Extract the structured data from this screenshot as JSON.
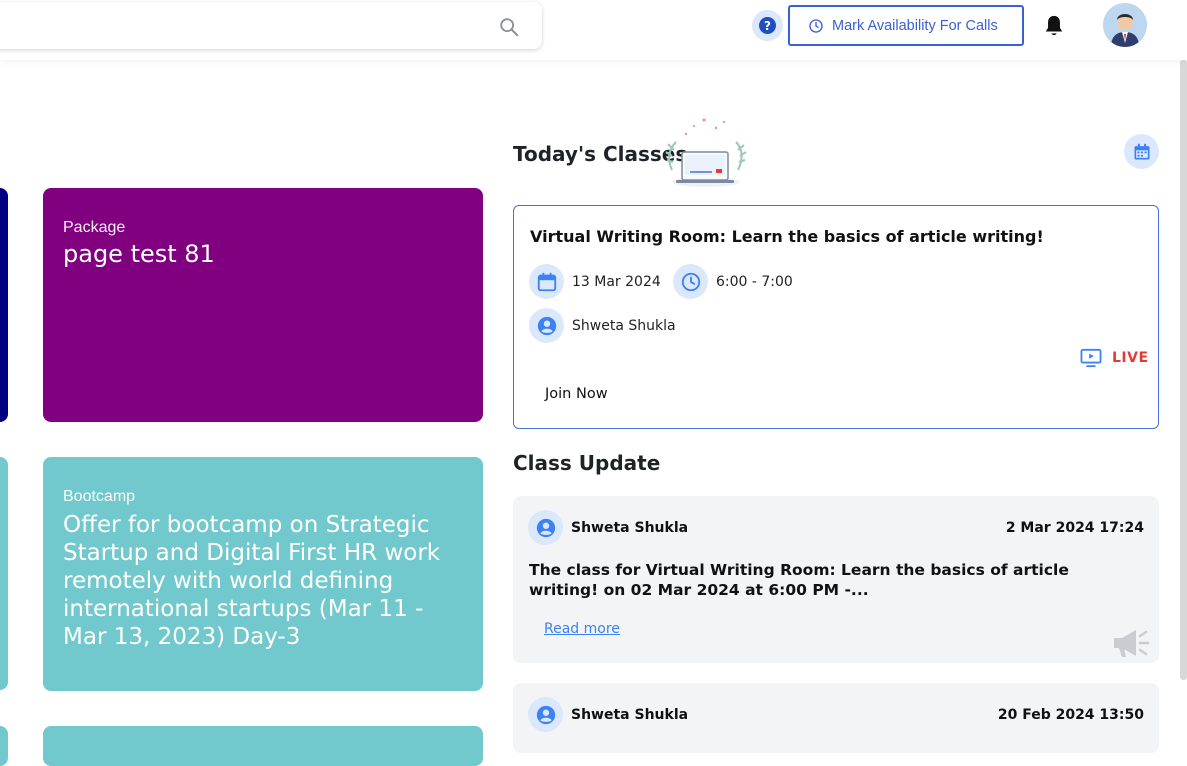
{
  "header": {
    "search": {
      "placeholder": "",
      "value": ""
    },
    "help_label": "?",
    "availability_button": "Mark Availability For Calls"
  },
  "cards": [
    {
      "kind": "Package",
      "title": "page test 81",
      "color": "#800080"
    },
    {
      "kind": "Bootcamp",
      "title": "Offer for bootcamp on Strategic Startup and Digital First HR work remotely with world defining international startups (Mar 11 - Mar 13, 2023) Day-3",
      "color": "#72c9cd"
    }
  ],
  "side_card_colors": {
    "navy": "#000080",
    "teal": "#72c9cd"
  },
  "todays_classes": {
    "heading": "Today's Classes",
    "class": {
      "title": "Virtual Writing Room: Learn the basics of article writing!",
      "date": "13 Mar 2024",
      "time": "6:00 - 7:00",
      "instructor": "Shweta Shukla",
      "status": "LIVE",
      "join_label": "Join Now"
    }
  },
  "class_update": {
    "heading": "Class Update",
    "items": [
      {
        "name": "Shweta Shukla",
        "date": "2 Mar 2024 17:24",
        "body": "The class for Virtual Writing Room: Learn the basics of article writing! on 02 Mar 2024 at 6:00 PM -...",
        "read_more": "Read more"
      },
      {
        "name": "Shweta Shukla",
        "date": "20 Feb 2024 13:50"
      }
    ]
  },
  "colors": {
    "accent": "#3b5fd6",
    "live": "#e53935",
    "icon_bg": "#dbe7fb"
  }
}
